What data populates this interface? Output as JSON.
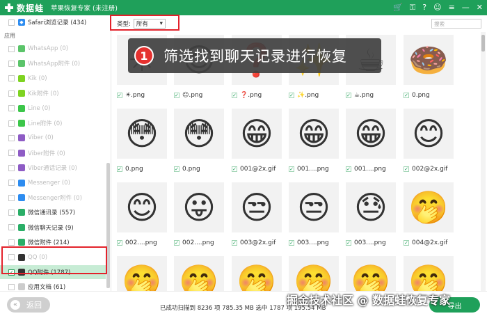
{
  "app": {
    "logo_text": "数据蛙",
    "window_title": "苹果恢复专家 (未注册)",
    "icons": [
      "cart-icon",
      "key-icon",
      "help-icon",
      "chat-icon",
      "menu-icon",
      "minimize-icon",
      "close-icon"
    ]
  },
  "sidebar": {
    "top_item": {
      "label": "Safari浏览记录 (434)"
    },
    "section_label": "应用",
    "items": [
      {
        "label": "WhatsApp (0)",
        "color": "#5bc46a"
      },
      {
        "label": "WhatsApp附件 (0)",
        "color": "#5bc46a"
      },
      {
        "label": "Kik (0)",
        "color": "#7ed321"
      },
      {
        "label": "Kik附件 (0)",
        "color": "#7ed321"
      },
      {
        "label": "Line (0)",
        "color": "#3cc64a"
      },
      {
        "label": "Line附件 (0)",
        "color": "#3cc64a"
      },
      {
        "label": "Viber (0)",
        "color": "#8e5cc5"
      },
      {
        "label": "Viber附件 (0)",
        "color": "#8e5cc5"
      },
      {
        "label": "Viber通话记录 (0)",
        "color": "#8e5cc5"
      },
      {
        "label": "Messenger (0)",
        "color": "#2d8cf0"
      },
      {
        "label": "Messenger附件 (0)",
        "color": "#2d8cf0"
      },
      {
        "label": "微信通讯录 (557)",
        "color": "#2aae67"
      },
      {
        "label": "微信聊天记录 (9)",
        "color": "#2aae67"
      },
      {
        "label": "微信附件 (214)",
        "color": "#2aae67"
      },
      {
        "label": "QQ (0)",
        "color": "#333333"
      },
      {
        "label": "QQ附件 (1787)",
        "color": "#333333"
      },
      {
        "label": "应用文档 (61)",
        "color": "#cccccc"
      }
    ]
  },
  "filter": {
    "label": "类型:",
    "selected": "所有",
    "search_placeholder": "搜索"
  },
  "banner": {
    "number": "1",
    "text": "筛选找到聊天记录进行恢复"
  },
  "grid": {
    "captions": [
      "☀.png",
      "☺.png",
      "❓.png",
      "✨.png",
      "☕.png",
      "0.png",
      "0.png",
      "0.png",
      "001@2x.gif",
      "001....png",
      "001....png",
      "002@2x.gif",
      "002....png",
      "002....png",
      "003@2x.gif",
      "003....png",
      "003....png",
      "004@2x.gif"
    ],
    "emojis": [
      "☀",
      "☺",
      "❓",
      "✨",
      "☕",
      "🍩",
      "😳",
      "😳",
      "😁",
      "😁",
      "😁",
      "😊",
      "😊",
      "😛",
      "😒",
      "😒",
      "😓",
      "🤭",
      "🤭",
      "🤭",
      "🤭",
      "🤭",
      "🤭",
      "🤭"
    ]
  },
  "bottom": {
    "back_label": "返回",
    "status": "已成功扫描到 8236 项 785.35 MB 选中 1787 项 195.54 MB",
    "export_label": "导出",
    "watermark": "掘金技术社区 @ 数据蛙恢复专家"
  }
}
